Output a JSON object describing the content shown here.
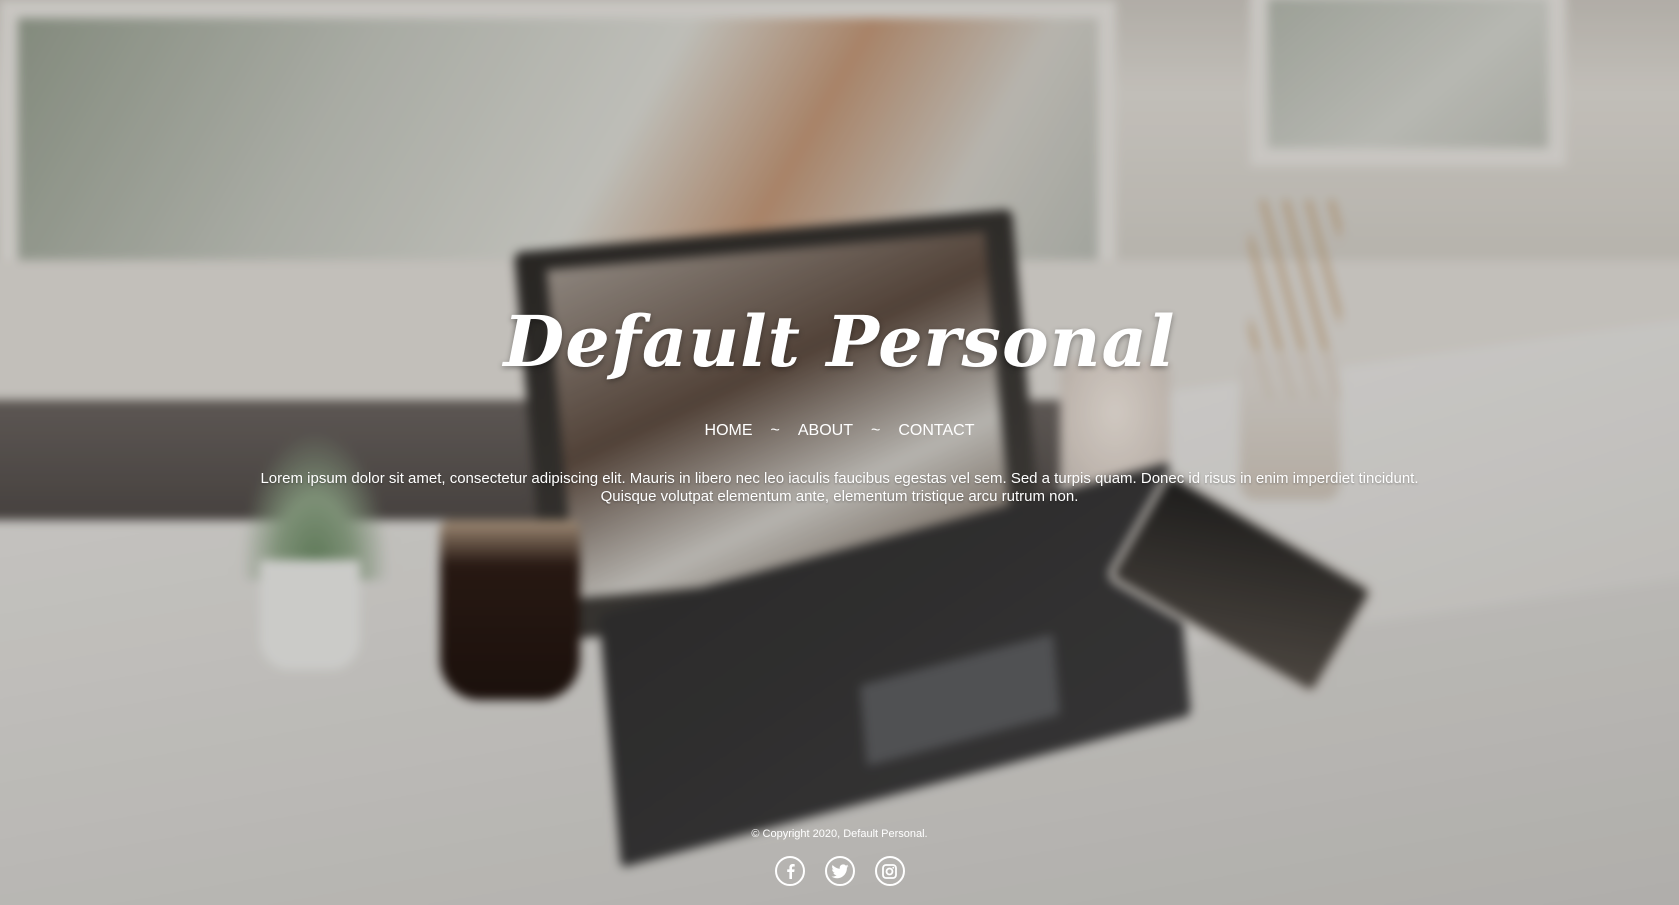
{
  "header": {
    "site_title": "Default Personal"
  },
  "nav": {
    "items": [
      {
        "label": "HOME"
      },
      {
        "label": "ABOUT"
      },
      {
        "label": "CONTACT"
      }
    ],
    "separator": "~"
  },
  "main": {
    "intro_line_1": "Lorem ipsum dolor sit amet, consectetur adipiscing elit. Mauris in libero nec leo iaculis faucibus egestas vel sem. Sed a turpis quam. Donec id risus in enim imperdiet tincidunt.",
    "intro_line_2": "Quisque volutpat elementum ante, elementum tristique arcu rutrum non."
  },
  "footer": {
    "copyright": "© Copyright 2020, Default Personal.",
    "social": [
      {
        "icon": "facebook-icon"
      },
      {
        "icon": "twitter-icon"
      },
      {
        "icon": "instagram-icon"
      }
    ]
  },
  "colors": {
    "text": "#ffffff"
  }
}
